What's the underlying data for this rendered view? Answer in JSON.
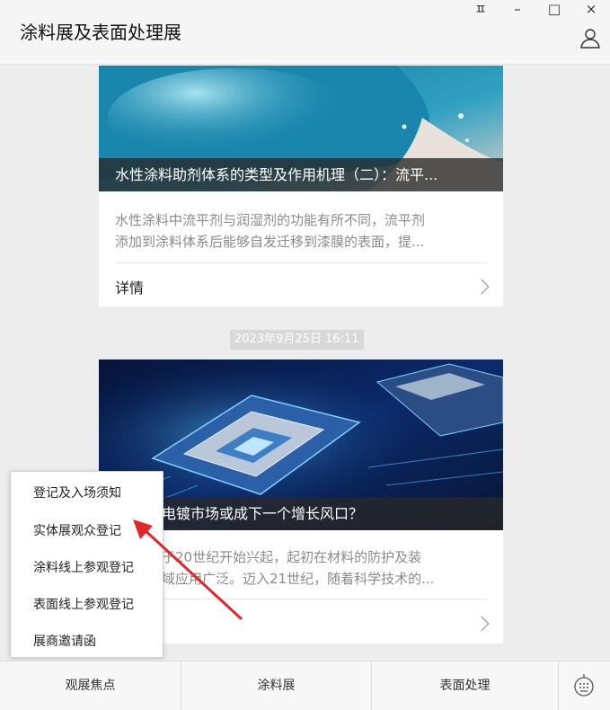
{
  "window": {
    "title": "涂料展及表面处理展",
    "controls": {
      "pin": "ㅍ",
      "minimize": "–",
      "maximize": "□",
      "close": "×"
    }
  },
  "feed": {
    "articles": [
      {
        "title": "水性涂料助剂体系的类型及作用机理（二）：流平...",
        "desc_line1": "水性涂料中流平剂与润湿剂的功能有所不同，流平剂",
        "desc_line2": "添加到涂料体系后能够自发迁移到漆膜的表面，提...",
        "detail_label": "详情"
      },
      {
        "timestamp": "2023年9月25日 16:11",
        "title_visible": "电镀市场或成下一个增长风口？",
        "desc_line1_visible": "于20世纪开始兴起，起初在材料的防护及装",
        "desc_line2_visible": "域应用广泛。迈入21世纪，随着科学技术的..."
      }
    ]
  },
  "popup_menu": {
    "items": [
      "登记及入场须知",
      "实体展观众登记",
      "涂料线上参观登记",
      "表面线上参观登记",
      "展商邀请函"
    ]
  },
  "bottom_menu": {
    "items": [
      "观展焦点",
      "涂料展",
      "表面处理"
    ]
  },
  "colors": {
    "annotation_arrow": "#e3262b",
    "title_bar": "#f5f5f5",
    "background": "#ededed"
  },
  "icons": [
    "pin-icon",
    "user-icon",
    "keyboard-icon",
    "chevron-right-icon"
  ]
}
